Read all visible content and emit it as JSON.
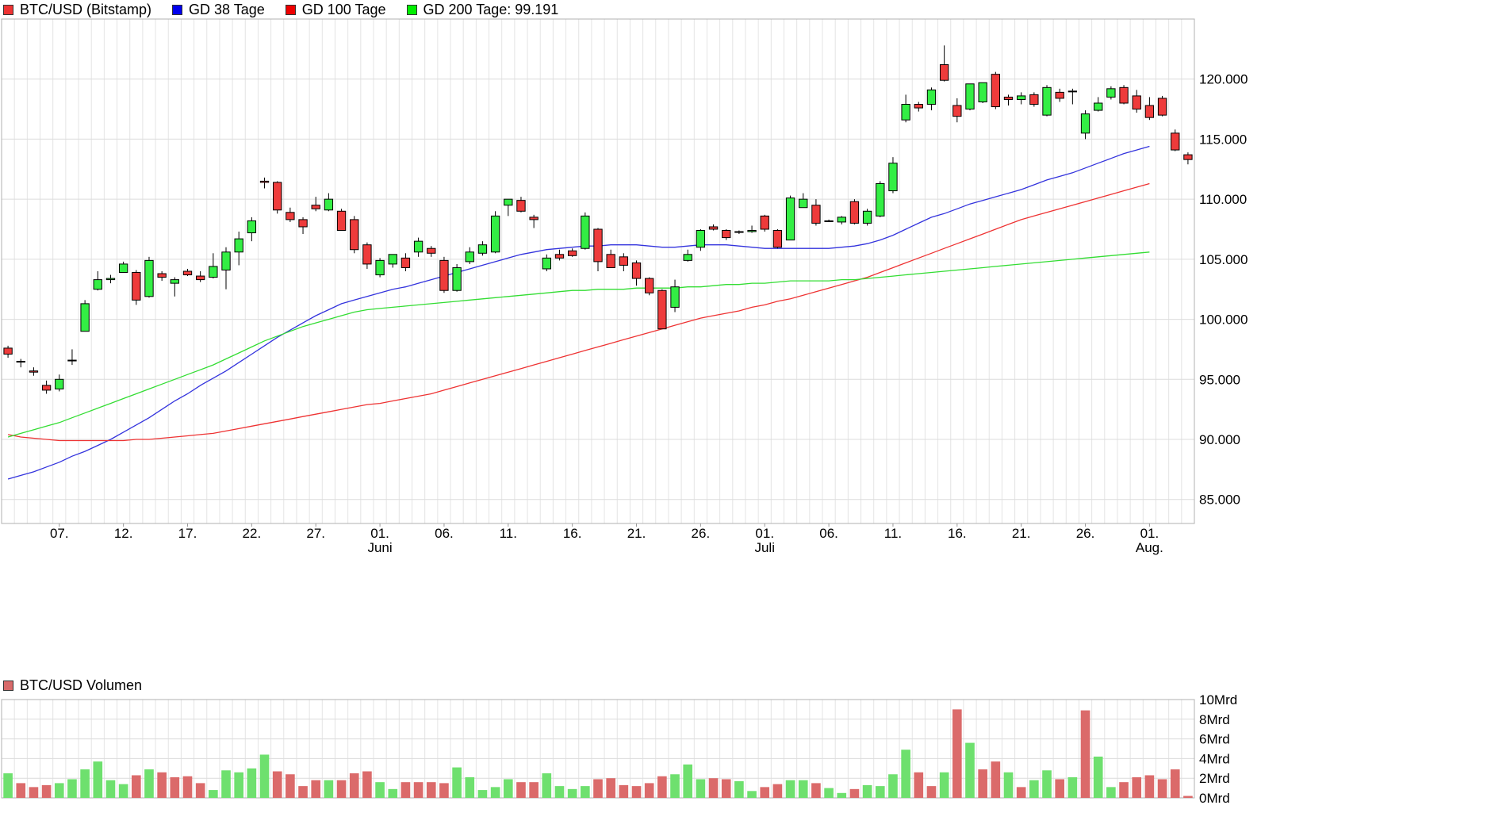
{
  "legend": {
    "price_items": [
      {
        "label": "BTC/USD (Bitstamp)",
        "color": "#ee3333"
      },
      {
        "label": "GD 38 Tage",
        "color": "#0000ee"
      },
      {
        "label": "GD 100 Tage",
        "color": "#ee0000"
      },
      {
        "label": "GD 200 Tage: 99.191",
        "color": "#00ee00"
      }
    ],
    "volume_label": "BTC/USD Volumen",
    "volume_color": "#d86a6a"
  },
  "chart_data": [
    {
      "type": "candlestick",
      "title": "BTC/USD (Bitstamp)",
      "ylim": [
        83000,
        125000
      ],
      "y_ticks": [
        85000,
        90000,
        95000,
        100000,
        105000,
        110000,
        115000,
        120000
      ],
      "y_tick_labels": [
        "85.000",
        "90.000",
        "95.000",
        "100.000",
        "105.000",
        "110.000",
        "115.000",
        "120.000"
      ],
      "x_tick_labels": [
        {
          "day": 4,
          "label": "07."
        },
        {
          "day": 9,
          "label": "12."
        },
        {
          "day": 14,
          "label": "17."
        },
        {
          "day": 19,
          "label": "22."
        },
        {
          "day": 24,
          "label": "27."
        },
        {
          "day": 29,
          "label": "01.",
          "month": "Juni"
        },
        {
          "day": 34,
          "label": "06."
        },
        {
          "day": 39,
          "label": "11."
        },
        {
          "day": 44,
          "label": "16."
        },
        {
          "day": 49,
          "label": "21."
        },
        {
          "day": 54,
          "label": "26."
        },
        {
          "day": 59,
          "label": "01.",
          "month": "Juli"
        },
        {
          "day": 64,
          "label": "06."
        },
        {
          "day": 69,
          "label": "11."
        },
        {
          "day": 74,
          "label": "16."
        },
        {
          "day": 79,
          "label": "21."
        },
        {
          "day": 84,
          "label": "26."
        },
        {
          "day": 89,
          "label": "01.",
          "month": "Aug."
        }
      ],
      "candles": [
        [
          97600,
          97800,
          96800,
          97100
        ],
        [
          96500,
          96700,
          96000,
          96500
        ],
        [
          95700,
          96000,
          95300,
          95600
        ],
        [
          94500,
          94900,
          93800,
          94100
        ],
        [
          94200,
          95400,
          94000,
          95000
        ],
        [
          96600,
          97500,
          96200,
          96600
        ],
        [
          99000,
          101600,
          99000,
          101300
        ],
        [
          102500,
          104000,
          102400,
          103300
        ],
        [
          103300,
          103700,
          103000,
          103400
        ],
        [
          103900,
          104800,
          103900,
          104600
        ],
        [
          103900,
          104100,
          101200,
          101600
        ],
        [
          101900,
          105200,
          101800,
          104900
        ],
        [
          103800,
          104000,
          103200,
          103500
        ],
        [
          103000,
          103500,
          101900,
          103300
        ],
        [
          104000,
          104200,
          103600,
          103700
        ],
        [
          103600,
          104000,
          103100,
          103300
        ],
        [
          103500,
          105500,
          103400,
          104400
        ],
        [
          104100,
          106000,
          102500,
          105600
        ],
        [
          105600,
          107300,
          104500,
          106700
        ],
        [
          107200,
          108500,
          106500,
          108200
        ],
        [
          111500,
          111800,
          110900,
          111400
        ],
        [
          111400,
          111500,
          108800,
          109100
        ],
        [
          108900,
          109300,
          108100,
          108300
        ],
        [
          108300,
          108500,
          107100,
          107700
        ],
        [
          109500,
          110200,
          109000,
          109200
        ],
        [
          109100,
          110500,
          109000,
          110000
        ],
        [
          109000,
          109200,
          107500,
          107400
        ],
        [
          108300,
          108600,
          105500,
          105800
        ],
        [
          106200,
          106400,
          104200,
          104600
        ],
        [
          103700,
          105100,
          103500,
          104900
        ],
        [
          104600,
          105400,
          104300,
          105400
        ],
        [
          105100,
          105500,
          104000,
          104300
        ],
        [
          105600,
          106800,
          105200,
          106500
        ],
        [
          105900,
          106100,
          105200,
          105500
        ],
        [
          104900,
          105200,
          102200,
          102400
        ],
        [
          102400,
          104600,
          102300,
          104300
        ],
        [
          104800,
          106000,
          104600,
          105600
        ],
        [
          105500,
          106500,
          105300,
          106200
        ],
        [
          105600,
          109000,
          105500,
          108600
        ],
        [
          109500,
          110000,
          108600,
          110000
        ],
        [
          109900,
          110200,
          108900,
          109000
        ],
        [
          108500,
          108700,
          107600,
          108300
        ],
        [
          104200,
          105400,
          104000,
          105100
        ],
        [
          105400,
          105800,
          104900,
          105100
        ],
        [
          105700,
          105900,
          105200,
          105300
        ],
        [
          105900,
          108900,
          105800,
          108600
        ],
        [
          107500,
          107600,
          104000,
          104800
        ],
        [
          105400,
          105800,
          104300,
          104300
        ],
        [
          105200,
          105500,
          104000,
          104500
        ],
        [
          104700,
          104900,
          102800,
          103400
        ],
        [
          103400,
          103500,
          102000,
          102200
        ],
        [
          102400,
          102500,
          99200,
          99200
        ],
        [
          101000,
          103300,
          100600,
          102700
        ],
        [
          104900,
          105800,
          104800,
          105400
        ],
        [
          106000,
          107500,
          105700,
          107400
        ],
        [
          107700,
          107900,
          107400,
          107500
        ],
        [
          107400,
          107500,
          106600,
          106800
        ],
        [
          107300,
          107400,
          107100,
          107300
        ],
        [
          107300,
          107800,
          107200,
          107400
        ],
        [
          108600,
          108700,
          107300,
          107500
        ],
        [
          107400,
          107500,
          105900,
          106000
        ],
        [
          106600,
          110300,
          106600,
          110100
        ],
        [
          109300,
          110500,
          109300,
          110000
        ],
        [
          109500,
          110000,
          107800,
          108000
        ],
        [
          108200,
          108300,
          108100,
          108200
        ],
        [
          108100,
          108600,
          107900,
          108500
        ],
        [
          109800,
          110000,
          107900,
          108000
        ],
        [
          108000,
          109200,
          107800,
          109000
        ],
        [
          108600,
          111500,
          108500,
          111300
        ],
        [
          110700,
          113500,
          110500,
          113000
        ],
        [
          116600,
          118700,
          116400,
          117900
        ],
        [
          117900,
          118100,
          117300,
          117600
        ],
        [
          117900,
          119300,
          117400,
          119100
        ],
        [
          121200,
          122800,
          119800,
          119900
        ],
        [
          117800,
          118400,
          116400,
          116900
        ],
        [
          117500,
          119600,
          117400,
          119600
        ],
        [
          118100,
          119700,
          118000,
          119700
        ],
        [
          120400,
          120600,
          117500,
          117700
        ],
        [
          118500,
          118700,
          117800,
          118300
        ],
        [
          118300,
          118900,
          117900,
          118600
        ],
        [
          118700,
          118900,
          117700,
          117900
        ],
        [
          117000,
          119500,
          116900,
          119300
        ],
        [
          118900,
          119200,
          118100,
          118400
        ],
        [
          119000,
          119200,
          117900,
          119000
        ],
        [
          115500,
          117400,
          115000,
          117100
        ],
        [
          117400,
          118500,
          117300,
          118000
        ],
        [
          118500,
          119400,
          118300,
          119200
        ],
        [
          119300,
          119500,
          117900,
          118000
        ],
        [
          118600,
          119100,
          117200,
          117500
        ],
        [
          117800,
          118500,
          116600,
          116800
        ],
        [
          118400,
          118600,
          116900,
          117000
        ],
        [
          115500,
          115800,
          114000,
          114100
        ],
        [
          113700,
          113900,
          112900,
          113300
        ]
      ],
      "series": [
        {
          "name": "GD 38 Tage",
          "color": "#3333dd",
          "values": [
            86700,
            87000,
            87300,
            87700,
            88100,
            88600,
            89000,
            89500,
            90000,
            90600,
            91200,
            91800,
            92500,
            93200,
            93800,
            94500,
            95100,
            95700,
            96400,
            97100,
            97800,
            98500,
            99100,
            99700,
            100300,
            100800,
            101300,
            101600,
            101900,
            102200,
            102500,
            102700,
            103000,
            103300,
            103600,
            103900,
            104200,
            104500,
            104800,
            105100,
            105400,
            105600,
            105800,
            105900,
            106000,
            106100,
            106100,
            106200,
            106200,
            106200,
            106100,
            106000,
            106000,
            106100,
            106200,
            106200,
            106200,
            106100,
            106000,
            105900,
            105900,
            105900,
            105900,
            105900,
            105900,
            106000,
            106100,
            106300,
            106600,
            107000,
            107500,
            108000,
            108500,
            108800,
            109200,
            109600,
            109900,
            110200,
            110500,
            110800,
            111200,
            111600,
            111900,
            112200,
            112600,
            113000,
            113400,
            113800,
            114100,
            114400
          ]
        },
        {
          "name": "GD 100 Tage",
          "color": "#ee3333",
          "values": [
            90400,
            90200,
            90100,
            90000,
            89900,
            89900,
            89900,
            89900,
            89900,
            89900,
            90000,
            90000,
            90100,
            90200,
            90300,
            90400,
            90500,
            90700,
            90900,
            91100,
            91300,
            91500,
            91700,
            91900,
            92100,
            92300,
            92500,
            92700,
            92900,
            93000,
            93200,
            93400,
            93600,
            93800,
            94100,
            94400,
            94700,
            95000,
            95300,
            95600,
            95900,
            96200,
            96500,
            96800,
            97100,
            97400,
            97700,
            98000,
            98300,
            98600,
            98900,
            99200,
            99500,
            99800,
            100100,
            100300,
            100500,
            100700,
            101000,
            101200,
            101500,
            101700,
            102000,
            102300,
            102600,
            102900,
            103200,
            103500,
            103900,
            104300,
            104700,
            105100,
            105500,
            105900,
            106300,
            106700,
            107100,
            107500,
            107900,
            108300,
            108600,
            108900,
            109200,
            109500,
            109800,
            110100,
            110400,
            110700,
            111000,
            111300
          ]
        },
        {
          "name": "GD 200 Tage",
          "color": "#33dd33",
          "values": [
            90200,
            90500,
            90800,
            91100,
            91400,
            91800,
            92200,
            92600,
            93000,
            93400,
            93800,
            94200,
            94600,
            95000,
            95400,
            95800,
            96200,
            96700,
            97200,
            97700,
            98200,
            98600,
            99000,
            99400,
            99700,
            100000,
            100300,
            100600,
            100800,
            100900,
            101000,
            101100,
            101200,
            101300,
            101400,
            101500,
            101600,
            101700,
            101800,
            101900,
            102000,
            102100,
            102200,
            102300,
            102400,
            102400,
            102500,
            102500,
            102500,
            102600,
            102600,
            102600,
            102600,
            102700,
            102700,
            102800,
            102900,
            102900,
            103000,
            103000,
            103100,
            103200,
            103200,
            103200,
            103200,
            103300,
            103300,
            103400,
            103500,
            103600,
            103700,
            103800,
            103900,
            104000,
            104100,
            104200,
            104300,
            104400,
            104500,
            104600,
            104700,
            104800,
            104900,
            105000,
            105100,
            105200,
            105300,
            105400,
            105500,
            105600
          ]
        }
      ]
    },
    {
      "type": "bar",
      "title": "BTC/USD Volumen",
      "ylim": [
        0,
        10
      ],
      "y_ticks": [
        0,
        2,
        4,
        6,
        8,
        10
      ],
      "y_tick_labels": [
        "0Mrd",
        "2Mrd",
        "4Mrd",
        "6Mrd",
        "8Mrd",
        "10Mrd"
      ],
      "unit": "Mrd",
      "values": [
        2.5,
        1.5,
        1.1,
        1.3,
        1.5,
        1.9,
        2.9,
        3.7,
        1.8,
        1.4,
        2.3,
        2.9,
        2.6,
        2.1,
        2.2,
        1.5,
        0.8,
        2.8,
        2.6,
        3.0,
        4.4,
        2.7,
        2.4,
        1.2,
        1.8,
        1.8,
        1.8,
        2.5,
        2.7,
        1.6,
        0.9,
        1.6,
        1.6,
        1.6,
        1.5,
        3.1,
        2.1,
        0.8,
        1.1,
        1.9,
        1.6,
        1.6,
        2.5,
        1.2,
        0.9,
        1.2,
        1.9,
        2.0,
        1.3,
        1.2,
        1.5,
        2.2,
        2.4,
        3.4,
        1.9,
        2.0,
        1.9,
        1.7,
        0.7,
        1.1,
        1.4,
        1.8,
        1.8,
        1.5,
        1.0,
        0.5,
        0.9,
        1.3,
        1.2,
        2.4,
        4.9,
        2.6,
        1.2,
        2.6,
        9.0,
        5.6,
        2.9,
        3.7,
        2.6,
        1.1,
        1.8,
        2.8,
        1.9,
        2.1,
        8.9,
        4.2,
        1.1,
        1.6,
        2.1,
        2.3,
        1.9,
        2.9,
        0.2
      ],
      "colors": [
        "g",
        "r",
        "r",
        "r",
        "g",
        "g",
        "g",
        "g",
        "g",
        "g",
        "r",
        "g",
        "r",
        "r",
        "r",
        "r",
        "g",
        "g",
        "g",
        "g",
        "g",
        "r",
        "r",
        "r",
        "r",
        "g",
        "r",
        "r",
        "r",
        "g",
        "g",
        "r",
        "r",
        "r",
        "r",
        "g",
        "g",
        "g",
        "g",
        "g",
        "r",
        "r",
        "g",
        "g",
        "g",
        "g",
        "r",
        "r",
        "r",
        "r",
        "r",
        "r",
        "g",
        "g",
        "g",
        "r",
        "r",
        "g",
        "g",
        "r",
        "r",
        "g",
        "g",
        "r",
        "g",
        "g",
        "r",
        "g",
        "g",
        "g",
        "g",
        "r",
        "r",
        "g",
        "r",
        "g",
        "r",
        "r",
        "g",
        "r",
        "g",
        "g",
        "r",
        "g",
        "r",
        "g",
        "g",
        "r",
        "r",
        "r",
        "r",
        "r",
        "r"
      ]
    }
  ]
}
